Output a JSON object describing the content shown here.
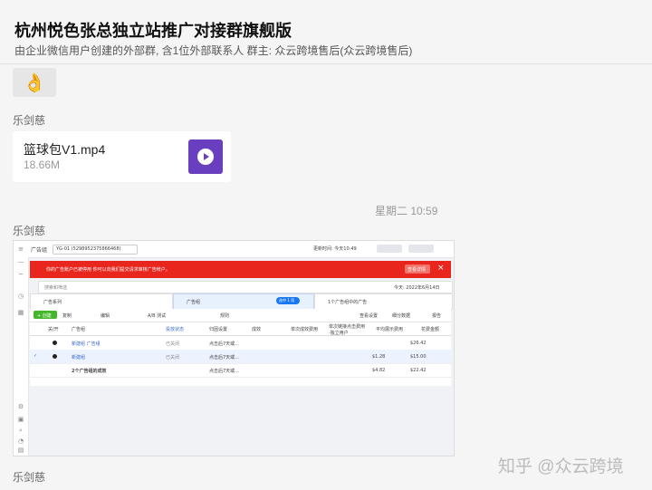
{
  "header": {
    "title": "杭州悦色张总独立站推广对接群旗舰版",
    "subtitle": "由企业微信用户创建的外部群, 含1位外部联系人 群主: 众云跨境售后(众云跨境售后)"
  },
  "messages": [
    {
      "sender": "乐剑慈",
      "type": "emoji",
      "emoji": "👌"
    },
    {
      "sender": "乐剑慈",
      "type": "file",
      "file_name": "篮球包V1.mp4",
      "file_size": "18.66M",
      "icon": "video-play-icon"
    },
    {
      "timestamp": "星期二 10:59"
    },
    {
      "sender": "乐剑慈",
      "type": "image"
    },
    {
      "sender": "乐剑慈"
    }
  ],
  "screenshot": {
    "topbar_title": "广告组",
    "account": "YG-01 (5298952375866468)",
    "updated": "更新时间: 今天10:49",
    "alert_text": "你的广告账户已被停用  你可以向我们提交请求审核广告帐户。",
    "alert_button": "查看详情",
    "search_placeholder": "搜索和筛选",
    "date_range": "今天: 2022年6月14日",
    "tabs": [
      "广告系列",
      "广告组",
      "1个广告组中的广告"
    ],
    "tab_tag": "选中 1 项",
    "toolbar": [
      "+ 创建",
      "复制",
      "编辑",
      "A/B 测试",
      "规则"
    ],
    "toolbar_right": [
      "查看设置",
      "细分数据",
      "报告"
    ],
    "columns": [
      "关/开",
      "广告组",
      "投放状态",
      "归因设置",
      "成效",
      "单次成效费用",
      "单次链接点击费用·独立用户",
      "平均展示费用",
      "花费金额"
    ],
    "rows": [
      {
        "name": "新建组 广告组",
        "status": "已关闭",
        "attr": "点击后7天或...",
        "cost1": "$1.28",
        "spend": "$26.42"
      },
      {
        "name": "新建组",
        "status": "已关闭",
        "attr": "点击后7天或...",
        "cost1": "$1.28",
        "spend": "$15.00"
      },
      {
        "name": "2个广告组的成效",
        "status": "",
        "attr": "点击后7天或...",
        "cost1": "$4.82",
        "spend": "$22.42"
      }
    ]
  },
  "last_sender": "乐剑慈",
  "watermark": "知乎 @众云跨境"
}
